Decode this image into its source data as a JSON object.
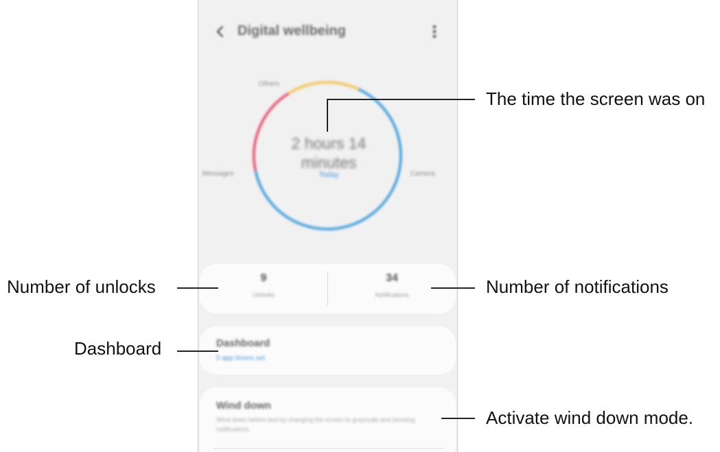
{
  "app": {
    "title": "Digital wellbeing",
    "back_icon": "chevron-left-icon",
    "more_icon": "more-vert-icon"
  },
  "usage_chart": {
    "center_time": "2 hours 14 minutes",
    "period": "Today",
    "segment_labels": {
      "others": "Others",
      "messages": "Messages",
      "camera": "Camera"
    },
    "colors": {
      "camera": "#4ea6e0",
      "messages": "#e85d7a",
      "others": "#f2c863"
    }
  },
  "stats": {
    "unlocks_count": "9",
    "unlocks_label": "Unlocks",
    "notifications_count": "34",
    "notifications_label": "Notifications"
  },
  "dashboard": {
    "title": "Dashboard",
    "subtitle": "0 app timers set"
  },
  "wind_down": {
    "title": "Wind down",
    "description": "Wind down before bed by changing the screen to grayscale and blocking notifications."
  },
  "callouts": {
    "screen_time": "The time the screen was on",
    "unlocks": "Number of unlocks",
    "notifications": "Number of notifications",
    "dashboard": "Dashboard",
    "wind_down": "Activate wind down mode."
  }
}
